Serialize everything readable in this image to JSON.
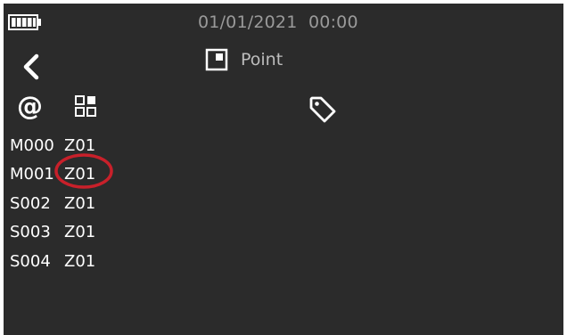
{
  "status_bar": {
    "battery_icon": "battery-full-icon",
    "datetime": "01/01/2021  00:00"
  },
  "nav": {
    "back_icon": "chevron-left-icon"
  },
  "mode": {
    "icon": "point-mode-icon",
    "label": "Point"
  },
  "columns": [
    {
      "icon": "at-icon",
      "symbol": "@"
    },
    {
      "icon": "grid-icon"
    },
    {
      "icon": "tag-icon"
    }
  ],
  "rows": [
    {
      "id": "M000",
      "zone": "Z01"
    },
    {
      "id": "M001",
      "zone": "Z01"
    },
    {
      "id": "S002",
      "zone": "Z01"
    },
    {
      "id": "S003",
      "zone": "Z01"
    },
    {
      "id": "S004",
      "zone": "Z01"
    }
  ],
  "annotation": {
    "type": "red-circle",
    "target_row": 1,
    "color": "#c8202a"
  },
  "colors": {
    "background": "#2b2b2b",
    "text": "#ffffff",
    "muted_text": "#9a9a9a"
  }
}
